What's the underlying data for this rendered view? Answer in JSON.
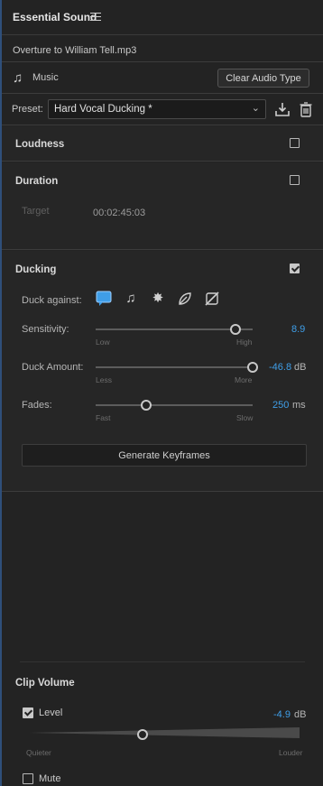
{
  "panel": {
    "title": "Essential Sound"
  },
  "clip": {
    "filename": "Overture to William Tell.mp3"
  },
  "audio_type": {
    "label": "Music",
    "clear_button": "Clear Audio Type",
    "icon": "music-note-icon"
  },
  "preset": {
    "label": "Preset:",
    "value": "Hard Vocal Ducking *"
  },
  "loudness": {
    "title": "Loudness",
    "checked": false
  },
  "duration": {
    "title": "Duration",
    "checked": false,
    "target_label": "Target",
    "target_value": "00:02:45:03"
  },
  "ducking": {
    "title": "Ducking",
    "checked": true,
    "duck_against_label": "Duck against:",
    "duck_icons": [
      "dialogue-icon",
      "music-note-icon",
      "sfx-burst-icon",
      "ambience-leaf-icon",
      "unassigned-icon"
    ],
    "sensitivity": {
      "label": "Sensitivity:",
      "min_label": "Low",
      "max_label": "High",
      "value": "8.9",
      "fraction": 0.89
    },
    "duck_amount": {
      "label": "Duck Amount:",
      "min_label": "Less",
      "max_label": "More",
      "value": "-46.8",
      "unit": "dB",
      "fraction": 1.0
    },
    "fades": {
      "label": "Fades:",
      "min_label": "Fast",
      "max_label": "Slow",
      "value": "250",
      "unit": "ms",
      "fraction": 0.32
    },
    "generate_button": "Generate Keyframes"
  },
  "clip_volume": {
    "title": "Clip Volume",
    "level_label": "Level",
    "level_checked": true,
    "level_value": "-4.9",
    "level_unit": "dB",
    "min_label": "Quieter",
    "max_label": "Louder",
    "level_fraction": 0.42,
    "mute_label": "Mute",
    "mute_checked": false
  },
  "colors": {
    "accent": "#3f9ee8",
    "background": "#232323"
  }
}
